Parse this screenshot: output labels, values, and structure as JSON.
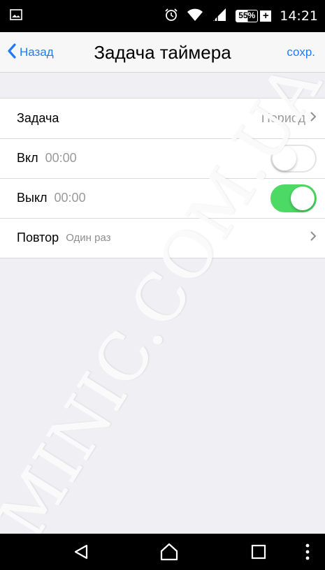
{
  "status_bar": {
    "time": "14:21",
    "battery_percent": "55%",
    "battery_level": 0.55,
    "icons": [
      "image-notification-icon",
      "alarm-icon",
      "wifi-icon",
      "signal-icon",
      "battery-icon",
      "charging-plus-icon"
    ]
  },
  "nav": {
    "back_label": "Назад",
    "title": "Задача таймера",
    "save_label": "сохр."
  },
  "rows": {
    "task": {
      "label": "Задача",
      "value": "Период"
    },
    "on": {
      "label": "Вкл",
      "time": "00:00",
      "enabled": false
    },
    "off": {
      "label": "Выкл",
      "time": "00:00",
      "enabled": true
    },
    "repeat": {
      "label": "Повтор",
      "value": "Один раз"
    }
  },
  "watermark": "MINIC.COM.UA",
  "colors": {
    "accent": "#1f7cf6",
    "toggle_on": "#4cd964",
    "background": "#efeff4"
  },
  "android_nav": [
    "back-icon",
    "home-icon",
    "recents-icon",
    "menu-icon"
  ]
}
